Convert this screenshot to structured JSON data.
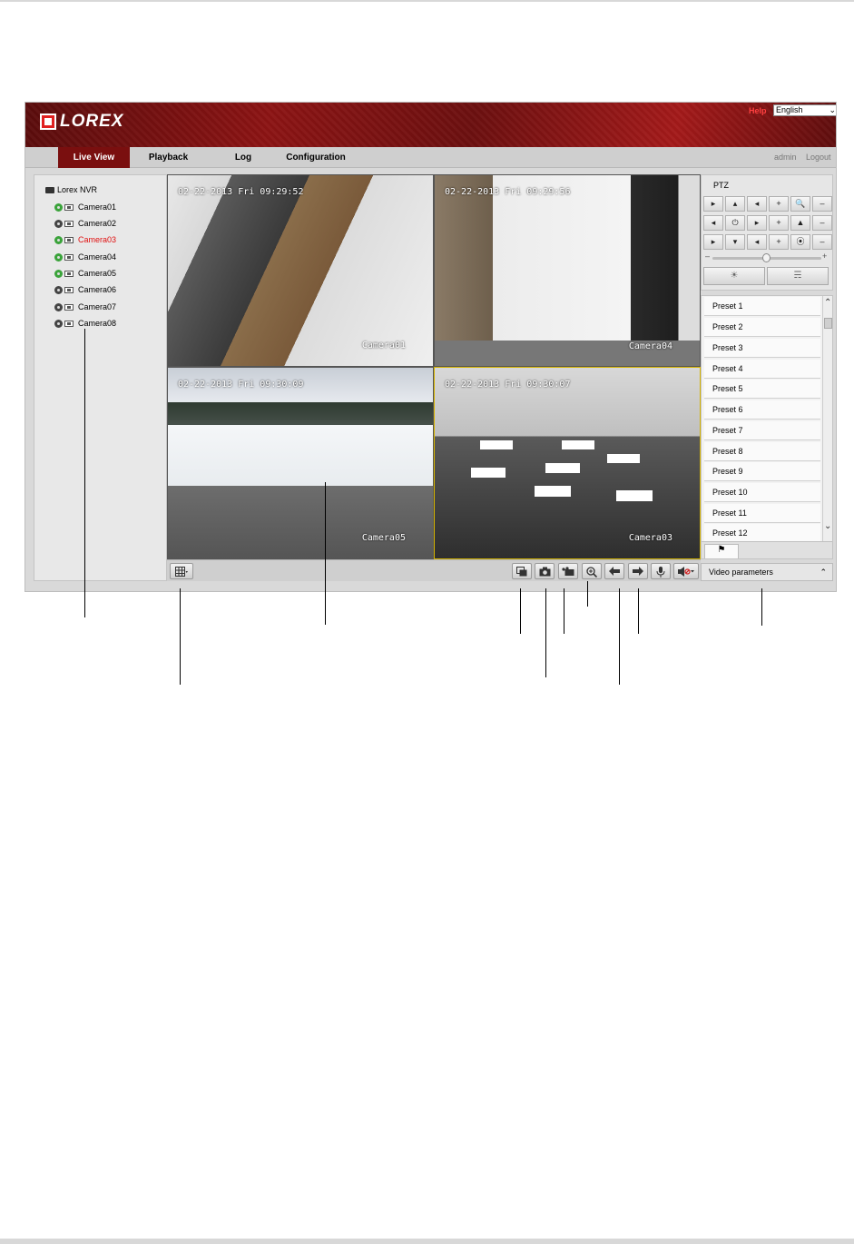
{
  "header": {
    "logo_text": "LOREX",
    "help_label": "Help",
    "language": "English"
  },
  "nav": {
    "tabs": [
      "Live View",
      "Playback",
      "Log",
      "Configuration"
    ],
    "active_tab": "Live View",
    "user": "admin",
    "logout": "Logout"
  },
  "tree": {
    "root": "Lorex NVR",
    "cameras": [
      "Camera01",
      "Camera02",
      "Camera03",
      "Camera04",
      "Camera05",
      "Camera06",
      "Camera07",
      "Camera08"
    ],
    "selected": "Camera03"
  },
  "video": {
    "tiles": [
      {
        "timestamp": "02-22-2013 Fri 09:29:52",
        "camera": "Camera01"
      },
      {
        "timestamp": "02-22-2013 Fri 09:29:56",
        "camera": "Camera04"
      },
      {
        "timestamp": "02-22-2013 Fri 09:30:09",
        "camera": "Camera05"
      },
      {
        "timestamp": "02-22-2013 Fri 09:30:07",
        "camera": "Camera03"
      }
    ]
  },
  "ptz": {
    "title": "PTZ",
    "presets": [
      "Preset 1",
      "Preset 2",
      "Preset 3",
      "Preset 4",
      "Preset 5",
      "Preset 6",
      "Preset 7",
      "Preset 8",
      "Preset 9",
      "Preset 10",
      "Preset 11",
      "Preset 12"
    ]
  },
  "video_parameters": {
    "label": "Video parameters"
  },
  "colors": {
    "accent": "#7a0f0f",
    "selected_camera": "#e01010"
  }
}
